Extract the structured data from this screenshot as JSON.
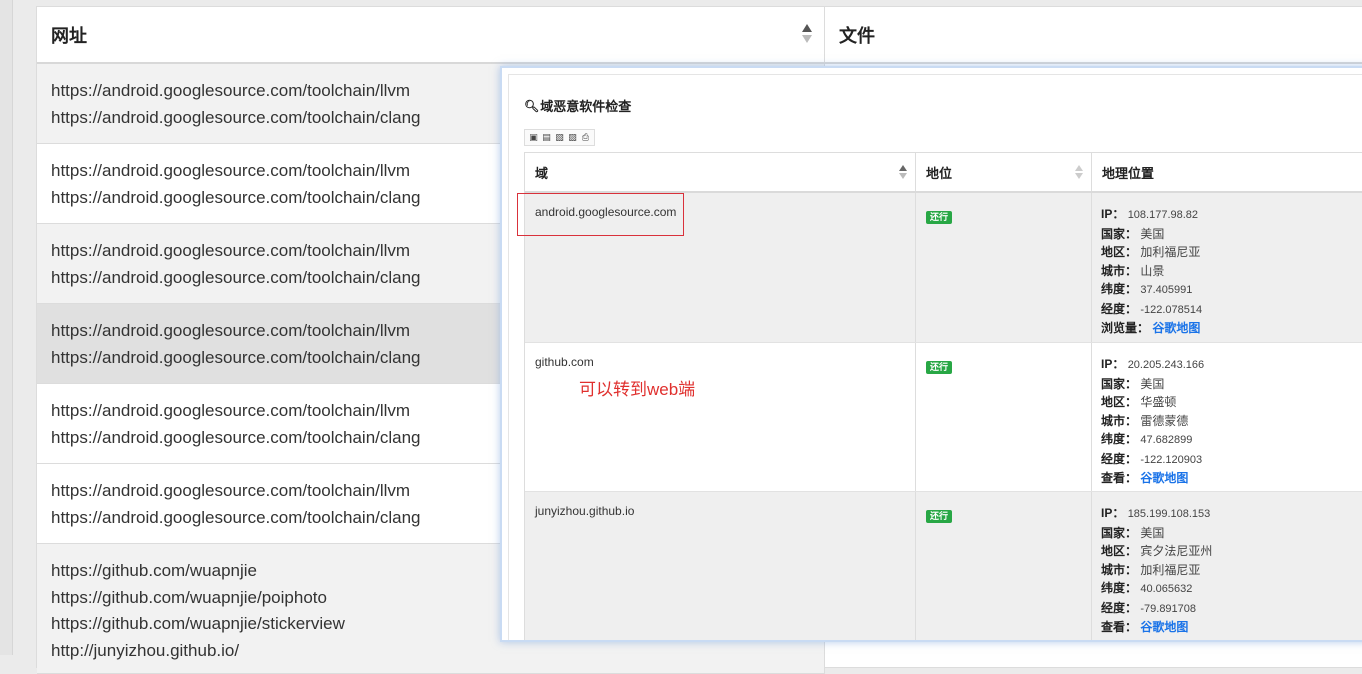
{
  "main_table": {
    "headers": [
      "网址",
      "文件"
    ],
    "rows": [
      {
        "lines": [
          "https://android.googlesource.com/toolchain/llvm",
          "https://android.googlesource.com/toolchain/clang"
        ]
      },
      {
        "lines": [
          "https://android.googlesource.com/toolchain/llvm",
          "https://android.googlesource.com/toolchain/clang"
        ]
      },
      {
        "lines": [
          "https://android.googlesource.com/toolchain/llvm",
          "https://android.googlesource.com/toolchain/clang"
        ]
      },
      {
        "lines": [
          "https://android.googlesource.com/toolchain/llvm",
          "https://android.googlesource.com/toolchain/clang"
        ]
      },
      {
        "lines": [
          "https://android.googlesource.com/toolchain/llvm",
          "https://android.googlesource.com/toolchain/clang"
        ]
      },
      {
        "lines": [
          "https://android.googlesource.com/toolchain/llvm",
          "https://android.googlesource.com/toolchain/clang"
        ]
      },
      {
        "lines": [
          "https://github.com/wuapnjie",
          "https://github.com/wuapnjie/poiphoto",
          "https://github.com/wuapnjie/stickerview",
          "http://junyizhou.github.io/"
        ]
      }
    ]
  },
  "modal": {
    "title": "域恶意软件检查",
    "toolbar_icons": [
      "copy-icon",
      "csv-icon",
      "excel-icon",
      "pdf-icon",
      "print-icon"
    ],
    "headers": [
      "域",
      "地位",
      "地理位置"
    ],
    "rows": [
      {
        "domain": "android.googlesource.com",
        "status": "还行",
        "geo": [
          {
            "k": "IP：",
            "v": "108.177.98.82"
          },
          {
            "k": "国家：",
            "v": "美国"
          },
          {
            "k": "地区：",
            "v": "加利福尼亚"
          },
          {
            "k": "城市：",
            "v": "山景"
          },
          {
            "k": "纬度：",
            "v": "37.405991"
          },
          {
            "k": "经度：",
            "v": "-122.078514"
          },
          {
            "k": "浏览量：",
            "link": "谷歌地图"
          }
        ]
      },
      {
        "domain": "github.com",
        "status": "还行",
        "geo": [
          {
            "k": "IP：",
            "v": "20.205.243.166"
          },
          {
            "k": "国家：",
            "v": "美国"
          },
          {
            "k": "地区：",
            "v": "华盛顿"
          },
          {
            "k": "城市：",
            "v": "雷德蒙德"
          },
          {
            "k": "纬度：",
            "v": "47.682899"
          },
          {
            "k": "经度：",
            "v": "-122.120903"
          },
          {
            "k": "查看：",
            "link": "谷歌地图"
          }
        ]
      },
      {
        "domain": "junyizhou.github.io",
        "status": "还行",
        "geo": [
          {
            "k": "IP：",
            "v": "185.199.108.153"
          },
          {
            "k": "国家：",
            "v": "美国"
          },
          {
            "k": "地区：",
            "v": "宾夕法尼亚州"
          },
          {
            "k": "城市：",
            "v": "加利福尼亚"
          },
          {
            "k": "纬度：",
            "v": "40.065632"
          },
          {
            "k": "经度：",
            "v": "-79.891708"
          },
          {
            "k": "查看：",
            "link": "谷歌地图"
          }
        ]
      }
    ]
  },
  "annotation": {
    "text": "可以转到web端",
    "color": "#e0302e"
  }
}
